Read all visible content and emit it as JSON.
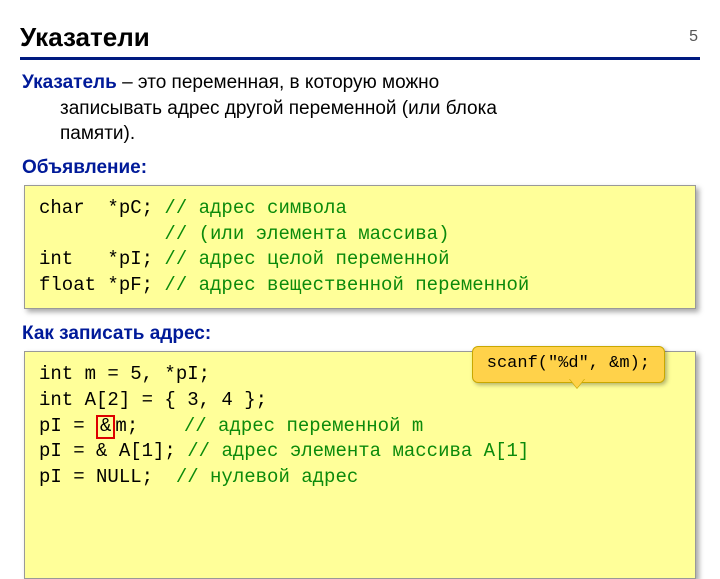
{
  "page_number": "5",
  "title": "Указатели",
  "definition": {
    "term": "Указатель",
    "rest_line1": " – это переменная, в которую можно",
    "line2": "записывать адрес другой переменной (или блока",
    "line3": "памяти)."
  },
  "section_declaration": "Объявление:",
  "code1": {
    "l1a": "char  *pC; ",
    "l1c": "// адрес символа",
    "l2a": "           ",
    "l2c": "// (или элемента массива)",
    "l3a": "int   *pI; ",
    "l3c": "// адрес целой переменной",
    "l4a": "float *pF; ",
    "l4c": "// адрес вещественной переменной"
  },
  "section_address": "Как записать адрес:",
  "code2": {
    "l1": "int m = 5, *pI;",
    "l2": "int A[2] = { 3, 4 };",
    "l3a": "pI = ",
    "l3_red": "&",
    "l3b": "m;    ",
    "l3c": "// адрес переменной m",
    "l4a": "pI = & A[1]; ",
    "l4c": "// адрес элемента массива A[1]",
    "l5a": "pI = NULL;  ",
    "l5c": "// нулевой адрес"
  },
  "callout": "scanf(\"%d\", &m);"
}
